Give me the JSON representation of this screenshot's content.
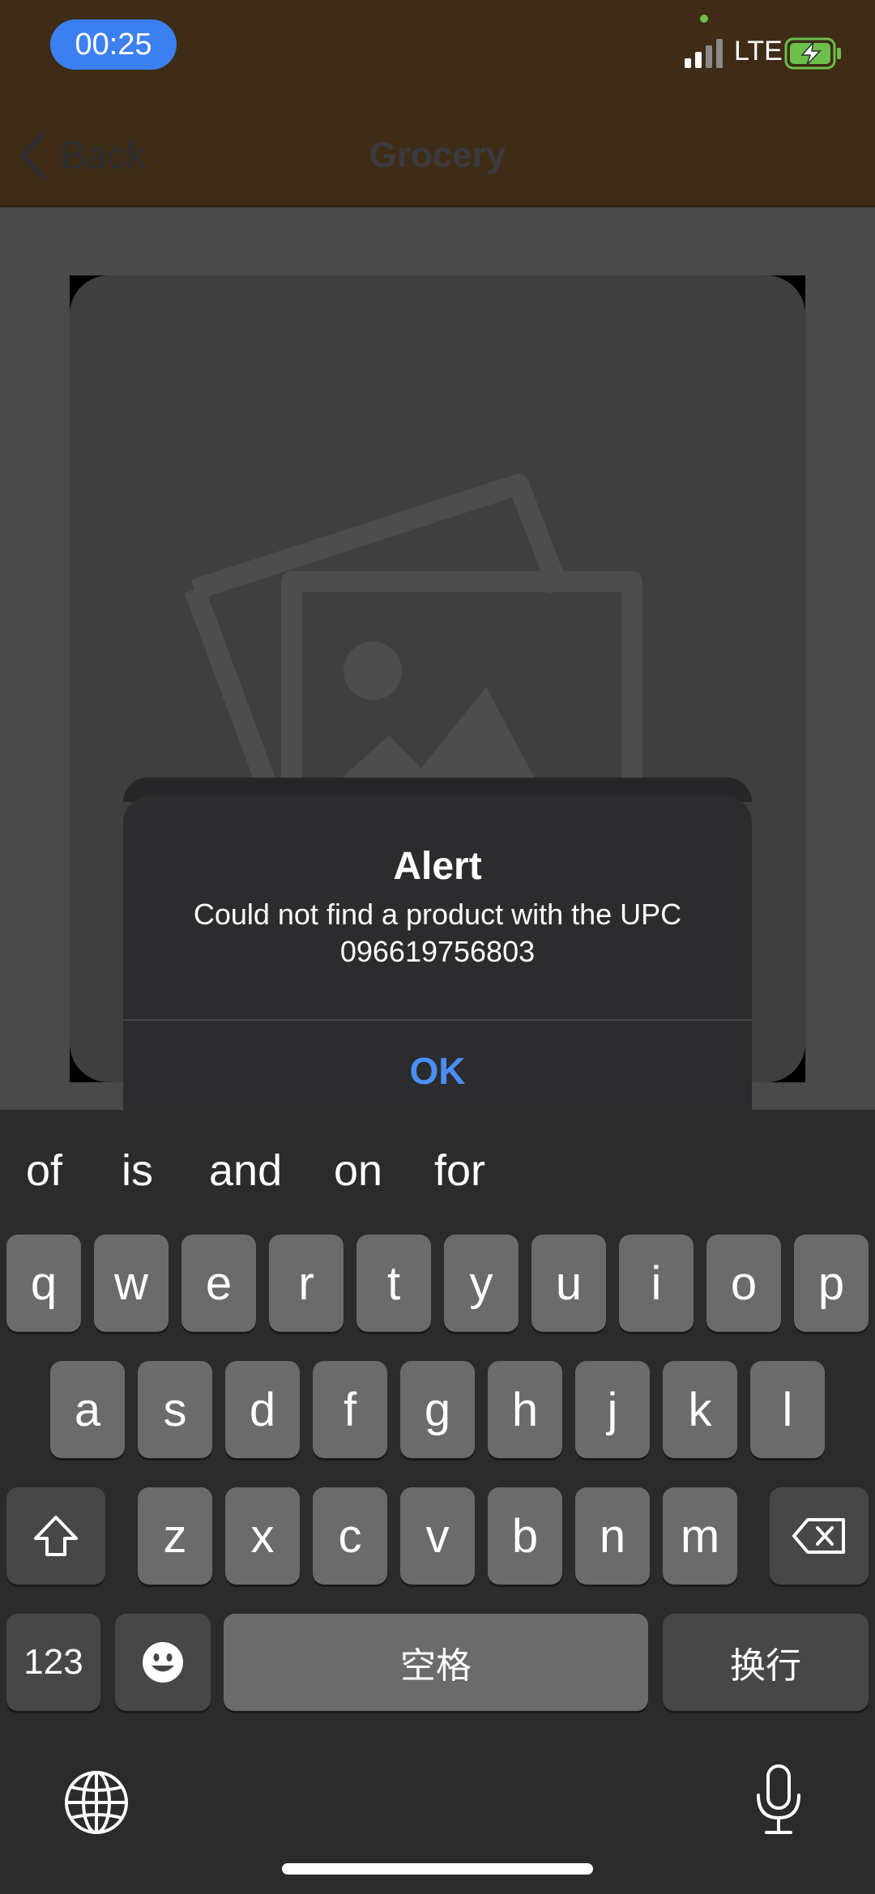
{
  "status": {
    "time": "00:25",
    "network": "LTE"
  },
  "nav": {
    "back_label": "Back",
    "title": "Grocery"
  },
  "alert": {
    "title": "Alert",
    "message": "Could not find a product with the UPC 096619756803",
    "ok_label": "OK"
  },
  "keyboard": {
    "suggestions": [
      "of",
      "is",
      "and",
      "on",
      "for"
    ],
    "row1": [
      "q",
      "w",
      "e",
      "r",
      "t",
      "y",
      "u",
      "i",
      "o",
      "p"
    ],
    "row2": [
      "a",
      "s",
      "d",
      "f",
      "g",
      "h",
      "j",
      "k",
      "l"
    ],
    "row3": [
      "z",
      "x",
      "c",
      "v",
      "b",
      "n",
      "m"
    ],
    "numbers_label": "123",
    "space_label": "空格",
    "return_label": "换行"
  },
  "icons": [
    "chevron-left-icon",
    "image-placeholder-icon",
    "shift-icon",
    "delete-icon",
    "emoji-icon",
    "globe-icon",
    "microphone-icon"
  ],
  "colors": {
    "accent": "#4a8ff5",
    "time_pill": "#3c7ff0",
    "header": "#3e2c17",
    "battery": "#6cc04a"
  }
}
